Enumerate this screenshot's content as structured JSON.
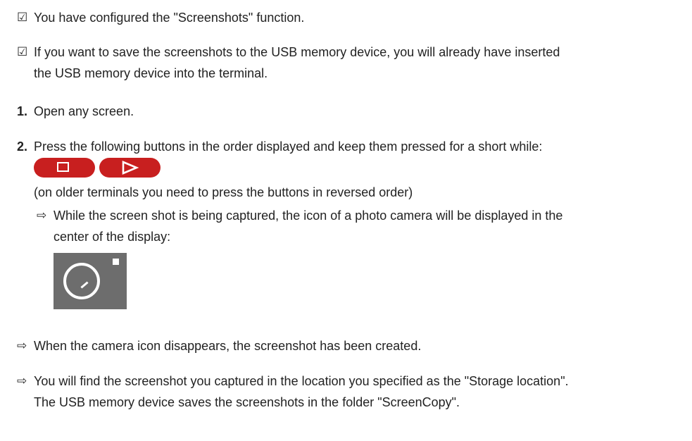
{
  "prerequisites": [
    {
      "check_symbol": "☑",
      "lines": [
        "You have configured the \"Screenshots\" function."
      ]
    },
    {
      "check_symbol": "☑",
      "lines": [
        "If you want to save the screenshots to the USB memory device, you will already have inserted",
        "the USB memory device into the terminal."
      ]
    }
  ],
  "steps": [
    {
      "number": "1.",
      "text": "Open any screen."
    },
    {
      "number": "2.",
      "text": "Press the following buttons in the order displayed and keep them pressed for a short while:",
      "buttons": [
        {
          "name": "stop-key",
          "icon": "square-icon",
          "color": "#c81f1f"
        },
        {
          "name": "play-key",
          "icon": "play-triangle-icon",
          "color": "#c81f1f"
        }
      ],
      "note": "(on older terminals you need to press the buttons in reversed order)",
      "result": {
        "arrow_symbol": "⇨",
        "lines": [
          "While the screen shot is being captured, the icon of a photo camera will be displayed in the",
          "center of the display:"
        ],
        "icon": "camera-icon",
        "icon_bg_color": "#6d6d6d"
      }
    }
  ],
  "results": [
    {
      "arrow_symbol": "⇨",
      "lines": [
        "When the camera icon disappears, the screenshot has been created."
      ]
    },
    {
      "arrow_symbol": "⇨",
      "lines": [
        "You will find the screenshot you captured in the location you specified as the \"Storage location\".",
        "The USB memory device saves the screenshots in the folder \"ScreenCopy\"."
      ]
    }
  ]
}
